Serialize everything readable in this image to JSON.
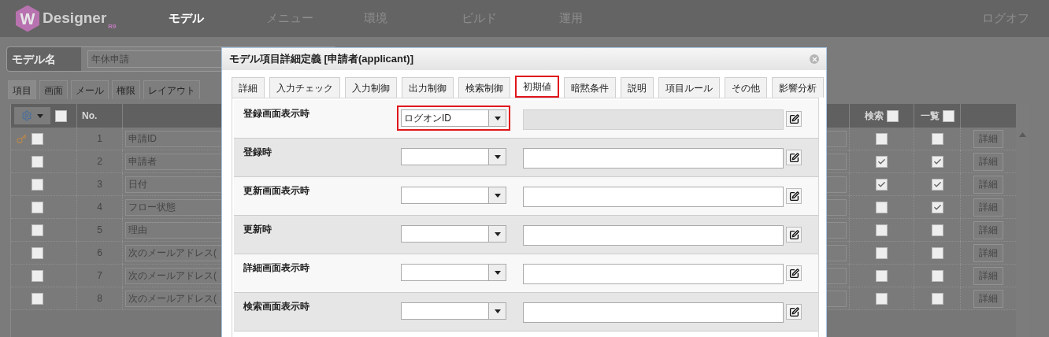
{
  "header": {
    "logo": {
      "mark": "W",
      "text": "Designer",
      "badge": "R9"
    },
    "nav": [
      {
        "label": "モデル",
        "selected": true
      },
      {
        "label": "メニュー",
        "selected": false
      },
      {
        "label": "環境",
        "selected": false
      },
      {
        "label": "ビルド",
        "selected": false
      },
      {
        "label": "運用",
        "selected": false
      }
    ],
    "logoff": "ログオフ"
  },
  "model_name": {
    "label": "モデル名",
    "value": "年休申請"
  },
  "page_tabs": [
    {
      "label": "項目",
      "selected": true
    },
    {
      "label": "画面",
      "selected": false
    },
    {
      "label": "メール",
      "selected": false
    },
    {
      "label": "権限",
      "selected": false
    },
    {
      "label": "レイアウト",
      "selected": false
    }
  ],
  "table": {
    "columns": {
      "no": "No.",
      "search": "検索",
      "list": "一覧"
    },
    "header_checks": {
      "all": false,
      "search": false,
      "list": false
    },
    "rows": [
      {
        "key": true,
        "checked": false,
        "no": "1",
        "name": "申請ID",
        "search": false,
        "list": false,
        "detail": "詳細"
      },
      {
        "key": false,
        "checked": false,
        "no": "2",
        "name": "申請者",
        "search": true,
        "list": true,
        "detail": "詳細"
      },
      {
        "key": false,
        "checked": false,
        "no": "3",
        "name": "日付",
        "search": true,
        "list": true,
        "detail": "詳細"
      },
      {
        "key": false,
        "checked": false,
        "no": "4",
        "name": "フロー状態",
        "search": false,
        "list": true,
        "detail": "詳細"
      },
      {
        "key": false,
        "checked": false,
        "no": "5",
        "name": "理由",
        "search": false,
        "list": false,
        "detail": "詳細"
      },
      {
        "key": false,
        "checked": false,
        "no": "6",
        "name": "次のメールアドレス(",
        "search": false,
        "list": false,
        "detail": "詳細"
      },
      {
        "key": false,
        "checked": false,
        "no": "7",
        "name": "次のメールアドレス(",
        "search": false,
        "list": false,
        "detail": "詳細"
      },
      {
        "key": false,
        "checked": false,
        "no": "8",
        "name": "次のメールアドレス(",
        "search": false,
        "list": false,
        "detail": "詳細"
      }
    ]
  },
  "dialog": {
    "title": "モデル項目詳細定義 [申請者(applicant)]",
    "tabs": [
      {
        "label": "詳細",
        "selected": false
      },
      {
        "label": "入力チェック",
        "selected": false
      },
      {
        "label": "入力制御",
        "selected": false
      },
      {
        "label": "出力制御",
        "selected": false
      },
      {
        "label": "検索制御",
        "selected": false
      },
      {
        "label": "初期値",
        "selected": true
      },
      {
        "label": "暗黙条件",
        "selected": false
      },
      {
        "label": "説明",
        "selected": false
      },
      {
        "label": "項目ルール",
        "selected": false
      },
      {
        "label": "その他",
        "selected": false
      },
      {
        "label": "影響分析",
        "selected": false
      }
    ],
    "rows": [
      {
        "label": "登録画面表示時",
        "value": "ログオンID",
        "highlighted": true,
        "text_disabled": true
      },
      {
        "label": "登録時",
        "highlighted": false,
        "text_disabled": false
      },
      {
        "label": "更新画面表示時",
        "highlighted": false,
        "text_disabled": false
      },
      {
        "label": "更新時",
        "highlighted": false,
        "text_disabled": false
      },
      {
        "label": "詳細画面表示時",
        "highlighted": false,
        "text_disabled": false
      },
      {
        "label": "検索画面表示時",
        "highlighted": false,
        "text_disabled": false
      }
    ]
  }
}
